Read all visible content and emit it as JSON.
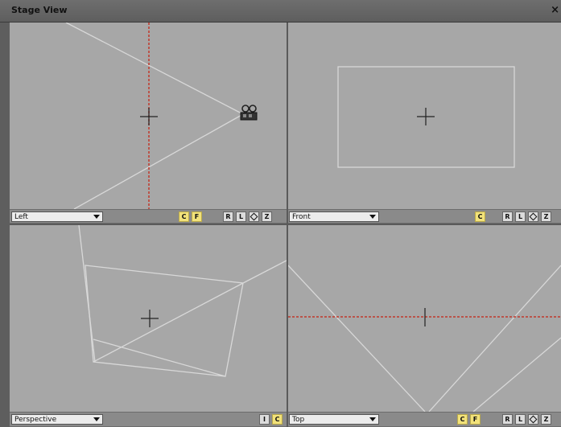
{
  "window": {
    "title": "Stage View",
    "close_glyph": "×"
  },
  "viewports": {
    "top_left": {
      "mode": "Left",
      "buttons": [
        "C",
        "F",
        "R",
        "L",
        "Z"
      ],
      "icon": "camera-icon"
    },
    "top_right": {
      "mode": "Front",
      "buttons": [
        "C",
        "R",
        "L",
        "Z"
      ]
    },
    "bottom_left": {
      "mode": "Perspective",
      "buttons": [
        "I",
        "C"
      ]
    },
    "bottom_right": {
      "mode": "Top",
      "buttons": [
        "C",
        "F",
        "R",
        "L",
        "Z"
      ]
    }
  },
  "colors": {
    "viewport_bg": "#a7a7a7",
    "guide_line": "#d8d8d8",
    "axis_red": "#c0392b",
    "toggle_active": "#f2e27a"
  }
}
